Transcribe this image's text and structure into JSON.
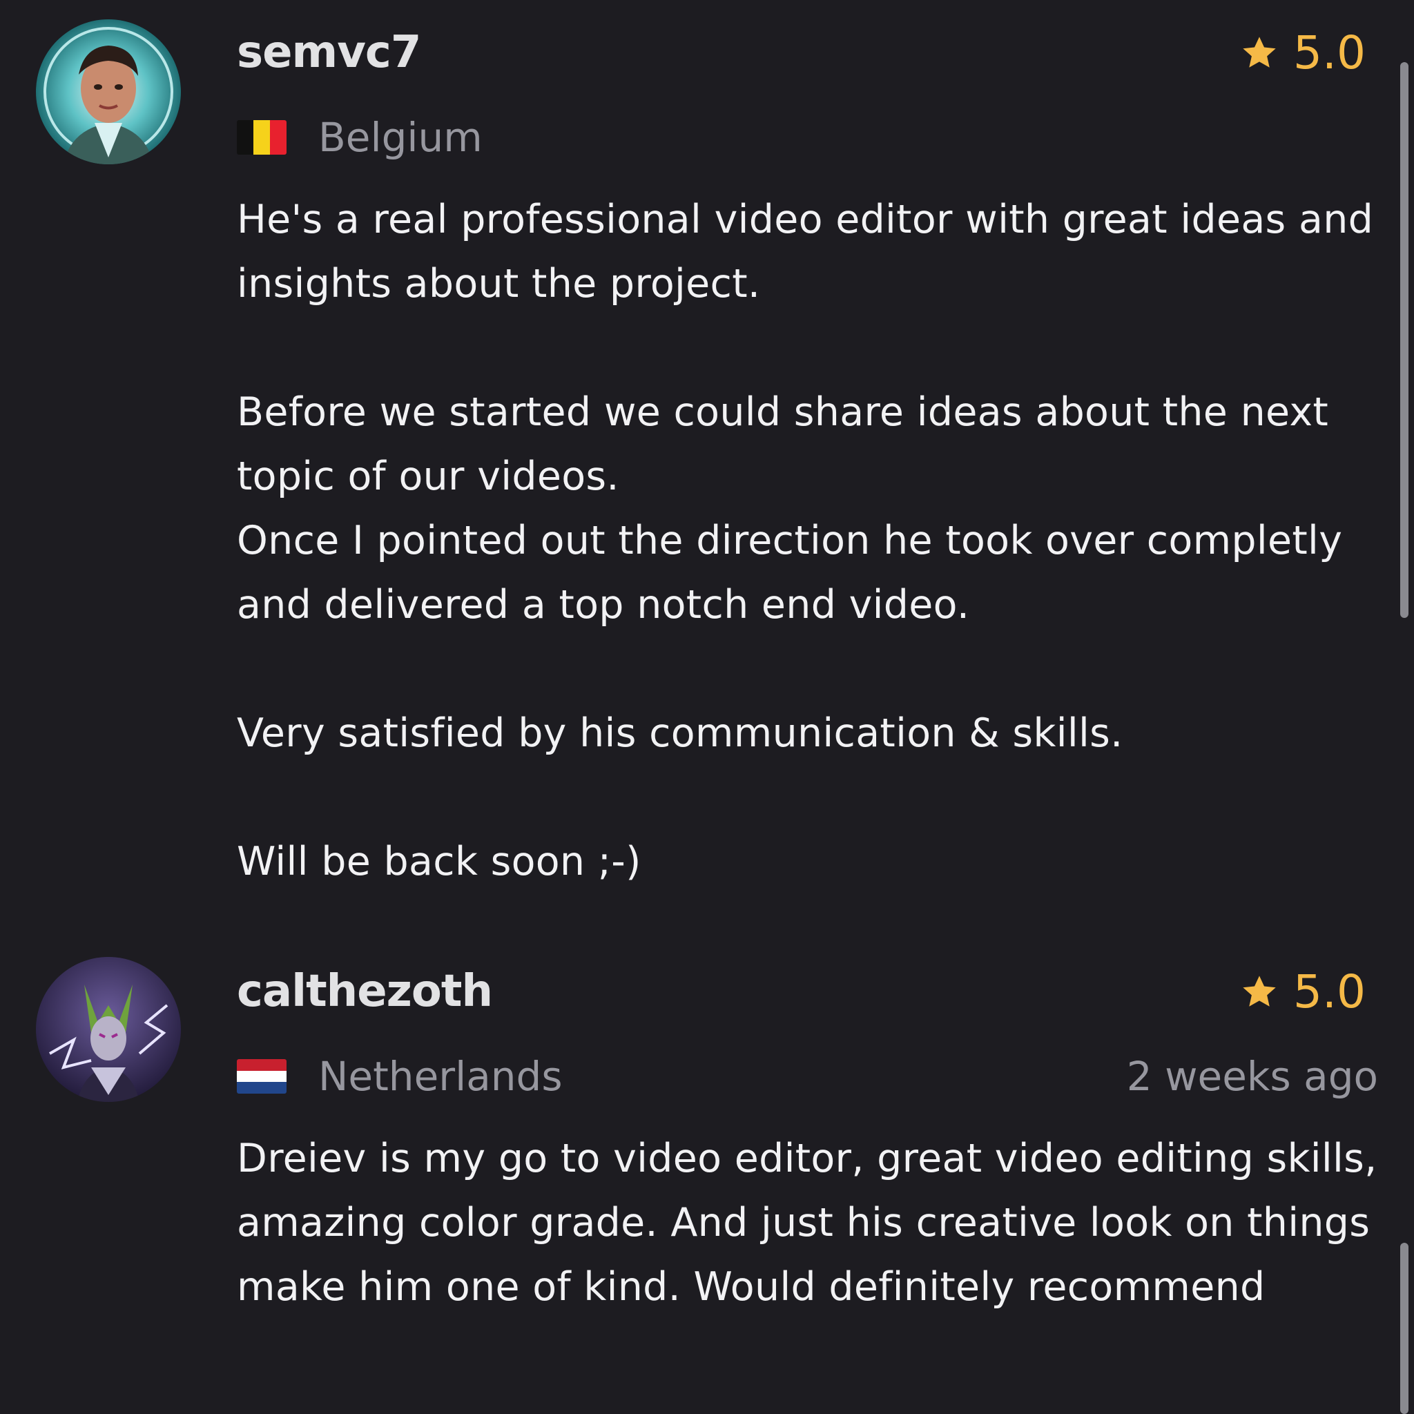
{
  "reviews": [
    {
      "username": "semvc7",
      "rating": "5.0",
      "country": "Belgium",
      "flag_colors": [
        "#111111",
        "#f6d21b",
        "#e8212e"
      ],
      "time_ago": "",
      "text": "He's a real professional video editor with great ideas and insights about the project.\n\nBefore we started we could share ideas about the next topic of our videos.\nOnce I pointed out the direction he took over completly and delivered a top notch end video.\n\nVery satisfied by his communication & skills.\n\nWill be back soon ;-)"
    },
    {
      "username": "calthezoth",
      "rating": "5.0",
      "country": "Netherlands",
      "flag_colors": [
        "#c8202e",
        "#ffffff",
        "#21468b"
      ],
      "time_ago": "2 weeks ago",
      "text": "Dreiev is my go to video editor, great video editing skills, amazing color grade. And just his creative look on things make him one of kind. Would definitely recommend"
    }
  ],
  "colors": {
    "background": "#1d1c21",
    "star": "#f5b947",
    "muted_text": "#97979f",
    "primary_text": "#f2f2f4"
  }
}
